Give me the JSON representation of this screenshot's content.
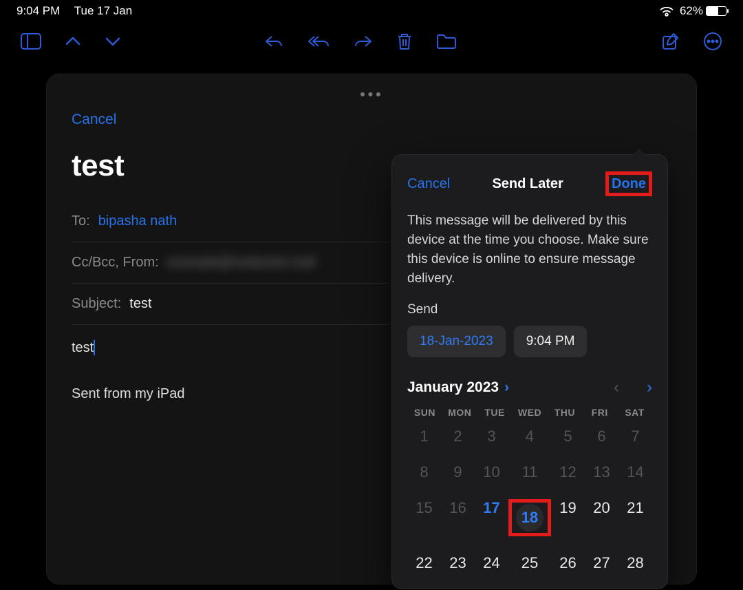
{
  "status": {
    "time": "9:04 PM",
    "date": "Tue 17 Jan",
    "battery_pct": "62%"
  },
  "compose": {
    "cancel": "Cancel",
    "subject_title": "test",
    "to_label": "To:",
    "to_value": "bipasha nath",
    "ccbcc_label": "Cc/Bcc, From:",
    "subject_label": "Subject:",
    "subject_value": "test",
    "body": "test",
    "signature": "Sent from my iPad"
  },
  "popover": {
    "cancel": "Cancel",
    "title": "Send Later",
    "done": "Done",
    "desc": "This message will be delivered by this device at the time you choose. Make sure this device is online to ensure message delivery.",
    "send_label": "Send",
    "date_pill": "18-Jan-2023",
    "time_pill": "9:04 PM",
    "month": "January 2023",
    "dow": [
      "SUN",
      "MON",
      "TUE",
      "WED",
      "THU",
      "FRI",
      "SAT"
    ],
    "weeks": [
      [
        "1",
        "2",
        "3",
        "4",
        "5",
        "6",
        "7"
      ],
      [
        "8",
        "9",
        "10",
        "11",
        "12",
        "13",
        "14"
      ],
      [
        "15",
        "16",
        "17",
        "18",
        "19",
        "20",
        "21"
      ],
      [
        "22",
        "23",
        "24",
        "25",
        "26",
        "27",
        "28"
      ]
    ],
    "today": "17",
    "selected": "18",
    "past_cutoff": 17
  }
}
